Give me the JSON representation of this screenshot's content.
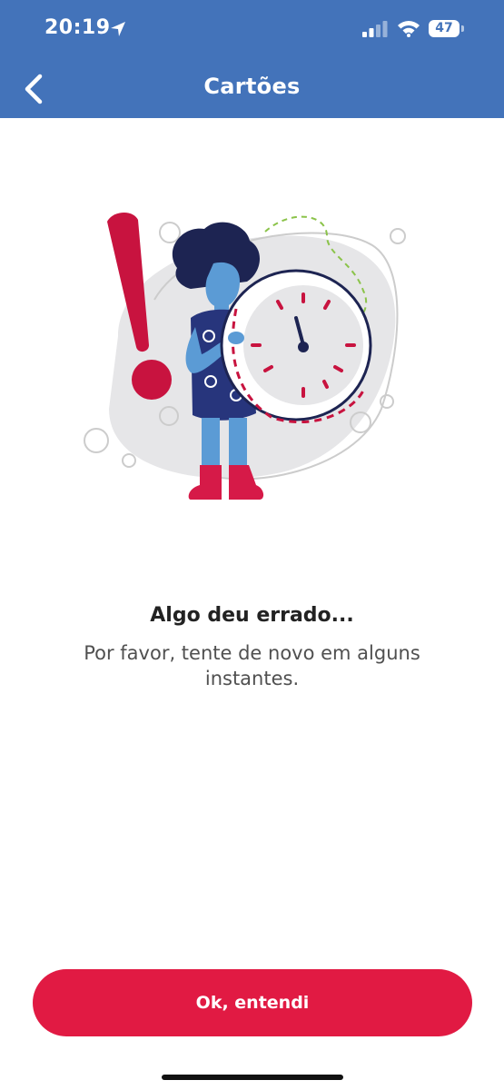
{
  "status_bar": {
    "time": "20:19",
    "battery": "47",
    "location_icon": "location-arrow",
    "signal_icon": "cellular-signal",
    "wifi_icon": "wifi"
  },
  "header": {
    "title": "Cartões",
    "back_icon": "chevron-left",
    "background_color": "#4373ba"
  },
  "error": {
    "title": "Algo deu errado...",
    "message": "Por favor, tente de novo em alguns instantes."
  },
  "actions": {
    "ok_label": "Ok, entendi",
    "button_color": "#e11a43"
  }
}
